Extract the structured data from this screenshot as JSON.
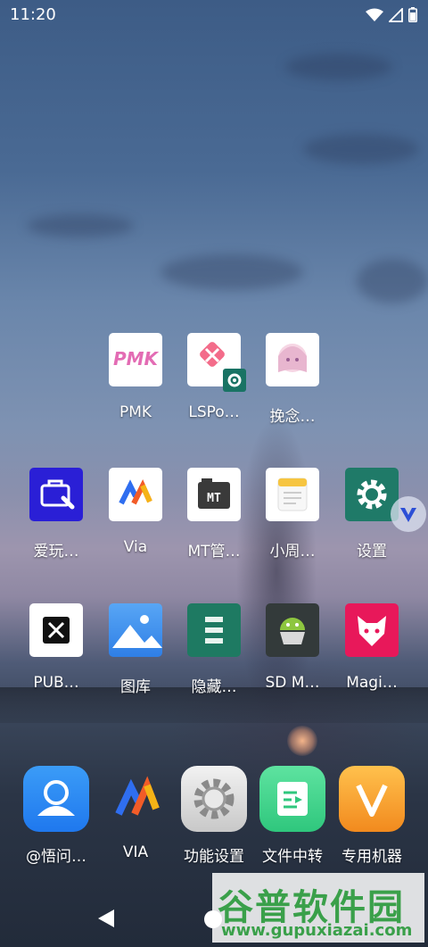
{
  "status_bar": {
    "time": "11:20"
  },
  "apps_row1": [
    {
      "label": "PMK",
      "icon": "pmk-logo-icon"
    },
    {
      "label": "LSPo…",
      "icon": "lsposed-icon"
    },
    {
      "label": "挽念…",
      "icon": "anime-avatar-icon"
    }
  ],
  "apps_row2": [
    {
      "label": "爱玩…",
      "icon": "toolbox-icon"
    },
    {
      "label": "Via",
      "icon": "via-browser-icon"
    },
    {
      "label": "MT管…",
      "icon": "mt-manager-icon"
    },
    {
      "label": "小周…",
      "icon": "notes-icon"
    },
    {
      "label": "设置",
      "icon": "settings-gear-icon"
    }
  ],
  "apps_row3": [
    {
      "label": "PUB…",
      "icon": "pub-tools-icon"
    },
    {
      "label": "图库",
      "icon": "gallery-icon"
    },
    {
      "label": "隐藏…",
      "icon": "hide-app-icon"
    },
    {
      "label": "SD M…",
      "icon": "sd-maid-icon"
    },
    {
      "label": "Magi…",
      "icon": "magisk-fox-icon"
    }
  ],
  "dock": [
    {
      "label": "@悟问…",
      "icon": "contact-icon"
    },
    {
      "label": "VIA",
      "icon": "via-icon"
    },
    {
      "label": "功能设置",
      "icon": "function-settings-icon"
    },
    {
      "label": "文件中转",
      "icon": "file-transfer-icon"
    },
    {
      "label": "专用机器",
      "icon": "dedicated-machine-icon"
    }
  ],
  "watermark": {
    "title": "谷普软件园",
    "url": "www.gupuxiazai.com"
  },
  "colors": {
    "settings_bg": "#1f7a68",
    "magisk_bg": "#e8185a",
    "via_orange": "#f28a1e",
    "dock_blue": "#2f8df5"
  }
}
